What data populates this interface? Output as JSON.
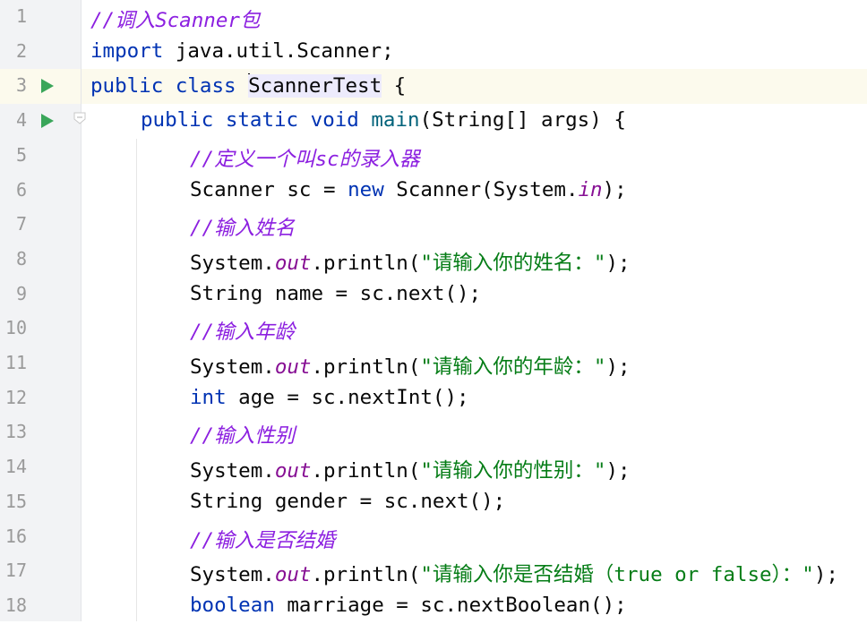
{
  "editor": {
    "colors": {
      "keyword": "#0033b3",
      "comment": "#8c20e0",
      "string": "#067d17",
      "field": "#871094",
      "method": "#00627a",
      "run_icon": "#3aa65a"
    },
    "lines": [
      {
        "num": "1",
        "parts": [
          "//调入Scanner包"
        ]
      },
      {
        "num": "2",
        "parts": [
          "import",
          " java.util.Scanner;"
        ]
      },
      {
        "num": "3",
        "parts": [
          "public class",
          " ",
          "ScannerTest",
          " {"
        ],
        "run_icon": "run-arrow-icon",
        "current": true
      },
      {
        "num": "4",
        "parts": [
          "public static void",
          " ",
          "main",
          "(String[] args) {"
        ],
        "run_icon": "run-arrow-icon",
        "fold_icon": "fold-marker-icon"
      },
      {
        "num": "5",
        "parts": [
          "//定义一个叫sc的录入器"
        ]
      },
      {
        "num": "6",
        "parts": [
          "Scanner sc = ",
          "new",
          " Scanner(System.",
          "in",
          ");"
        ]
      },
      {
        "num": "7",
        "parts": [
          "//输入姓名"
        ]
      },
      {
        "num": "8",
        "parts": [
          "System.",
          "out",
          ".println(",
          "\"请输入你的姓名：\"",
          ");"
        ]
      },
      {
        "num": "9",
        "parts": [
          "String name = sc.next();"
        ]
      },
      {
        "num": "10",
        "parts": [
          "//输入年龄"
        ]
      },
      {
        "num": "11",
        "parts": [
          "System.",
          "out",
          ".println(",
          "\"请输入你的年龄：\"",
          ");"
        ]
      },
      {
        "num": "12",
        "parts": [
          "int",
          " age = sc.nextInt();"
        ]
      },
      {
        "num": "13",
        "parts": [
          "//输入性别"
        ]
      },
      {
        "num": "14",
        "parts": [
          "System.",
          "out",
          ".println(",
          "\"请输入你的性别：\"",
          ");"
        ]
      },
      {
        "num": "15",
        "parts": [
          "String gender = sc.next();"
        ]
      },
      {
        "num": "16",
        "parts": [
          "//输入是否结婚"
        ]
      },
      {
        "num": "17",
        "parts": [
          "System.",
          "out",
          ".println(",
          "\"请输入你是否结婚（true or false）：\"",
          ");"
        ]
      },
      {
        "num": "18",
        "parts": [
          "boolean",
          " marriage = sc.nextBoolean();"
        ]
      }
    ]
  }
}
